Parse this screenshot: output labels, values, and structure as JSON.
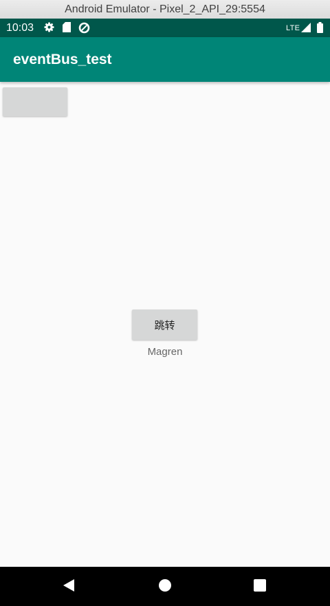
{
  "window": {
    "title": "Android Emulator - Pixel_2_API_29:5554"
  },
  "status_bar": {
    "time": "10:03",
    "network": "LTE",
    "icons": [
      "gear-icon",
      "sd-card-icon",
      "data-saver-icon",
      "signal-icon",
      "battery-icon"
    ]
  },
  "app_bar": {
    "title": "eventBus_test"
  },
  "main": {
    "top_button_label": "",
    "jump_button_label": "跳转",
    "name_text": "Magren"
  },
  "nav_bar": {
    "icons": [
      "back-icon",
      "home-icon",
      "recents-icon"
    ]
  },
  "colors": {
    "status_bar": "#00574b",
    "app_bar": "#008577",
    "background": "#fafafa",
    "button": "#d6d7d7",
    "nav_bar": "#000000"
  }
}
